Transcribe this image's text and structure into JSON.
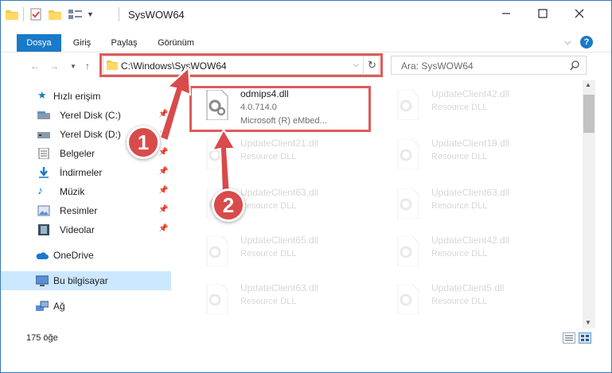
{
  "window": {
    "title": "SysWOW64"
  },
  "ribbon": {
    "tabs": [
      "Dosya",
      "Giriş",
      "Paylaş",
      "Görünüm"
    ]
  },
  "address": {
    "path": "C:\\Windows\\SysWOW64",
    "search_placeholder": "Ara: SysWOW64"
  },
  "nav": {
    "items": [
      {
        "label": "Hızlı erişim",
        "icon": "star-icon",
        "pinned": false
      },
      {
        "label": "Yerel Disk (C:)",
        "icon": "drive-icon",
        "pinned": true
      },
      {
        "label": "Yerel Disk (D:)",
        "icon": "drive-icon",
        "pinned": true
      },
      {
        "label": "Belgeler",
        "icon": "documents-icon",
        "pinned": true
      },
      {
        "label": "İndirmeler",
        "icon": "downloads-icon",
        "pinned": true
      },
      {
        "label": "Müzik",
        "icon": "music-icon",
        "pinned": true
      },
      {
        "label": "Resimler",
        "icon": "pictures-icon",
        "pinned": true
      },
      {
        "label": "Videolar",
        "icon": "videos-icon",
        "pinned": true
      },
      {
        "label": "OneDrive",
        "icon": "cloud-icon",
        "pinned": false
      },
      {
        "label": "Bu bilgisayar",
        "icon": "computer-icon",
        "pinned": false,
        "selected": true
      },
      {
        "label": "Ağ",
        "icon": "network-icon",
        "pinned": false
      }
    ]
  },
  "files": [
    {
      "name": "odmips4.dll",
      "line2": "4.0.714.0",
      "line3": "Microsoft (R) eMbed...",
      "highlighted": true
    },
    {
      "name": "UpdateClient42.dll",
      "line2": "Resource DLL"
    },
    {
      "name": "UpdateClient21.dll",
      "line2": "Resource DLL"
    },
    {
      "name": "UpdateClient19.dll",
      "line2": "Resource DLL"
    },
    {
      "name": "UpdateClient63.dll",
      "line2": "Resource DLL"
    },
    {
      "name": "UpdateClient63.dll",
      "line2": "Resource DLL"
    },
    {
      "name": "UpdateClient65.dll",
      "line2": "Resource DLL"
    },
    {
      "name": "UpdateClient42.dll",
      "line2": "Resource DLL"
    },
    {
      "name": "UpdateClient63.dll",
      "line2": "Resource DLL"
    },
    {
      "name": "UpdateClient5.dll",
      "line2": "Resource DLL"
    }
  ],
  "status": {
    "count": "175 öğe"
  },
  "callouts": [
    "1",
    "2"
  ],
  "colors": {
    "accent": "#1979ca",
    "highlight": "#e05a5a",
    "selection": "#cce8ff"
  }
}
